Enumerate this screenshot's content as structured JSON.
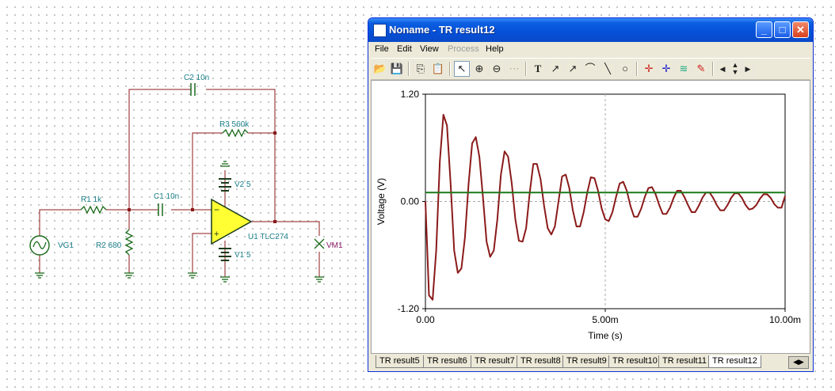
{
  "schematic": {
    "c2": "C2 10n",
    "r3": "R3 560k",
    "v2": "V2 5",
    "r1": "R1 1k",
    "c1": "C1 10n",
    "r2": "R2 680",
    "vg1": "VG1",
    "u1": "U1 TLC274",
    "vm1": "VM1",
    "v1": "V1 5"
  },
  "window": {
    "title": "Noname - TR result12",
    "menu": [
      "File",
      "Edit",
      "View",
      "Process",
      "Help"
    ],
    "minimize": "_",
    "maximize": "□",
    "close": "✕"
  },
  "toolbar_icons": [
    "open-icon",
    "save-icon",
    "copy-icon",
    "paste-icon",
    "pointer-icon",
    "zoom-in-icon",
    "zoom-100-icon",
    "grid-icon",
    "text-icon",
    "label-icon",
    "label-icon",
    "label-icon",
    "line-icon",
    "circle-icon",
    "cursor-a-icon",
    "cursor-b-icon",
    "add-curve-icon",
    "pick-icon",
    "arrow-left-icon",
    "arrow-updown-icon",
    "arrow-right-icon"
  ],
  "tabs": [
    "TR result5",
    "TR result6",
    "TR result7",
    "TR result8",
    "TR result9",
    "TR result10",
    "TR result11",
    "TR result12"
  ],
  "active_tab": "TR result12",
  "chart_data": {
    "type": "line",
    "xlabel": "Time (s)",
    "ylabel": "Voltage (V)",
    "xlim": [
      0,
      0.01
    ],
    "ylim": [
      -1.2,
      1.2
    ],
    "x_ticks": [
      "0.00",
      "5.00m",
      "10.00m"
    ],
    "y_ticks": [
      "1.20",
      "0.00",
      "-1.20"
    ],
    "grid": "dashed center lines",
    "series": [
      {
        "color": "#8b1a1a",
        "x": [
          0,
          0.0001,
          0.0002,
          0.0003,
          0.0004,
          0.0005,
          0.0006,
          0.0007,
          0.0008,
          0.0009,
          0.001,
          0.0011,
          0.0012,
          0.0013,
          0.0014,
          0.0015,
          0.0016,
          0.0017,
          0.0018,
          0.0019,
          0.002,
          0.0021,
          0.0022,
          0.0023,
          0.0024,
          0.0025,
          0.0026,
          0.0027,
          0.0028,
          0.0029,
          0.003,
          0.0031,
          0.0032,
          0.0033,
          0.0034,
          0.0035,
          0.0036,
          0.0037,
          0.0038,
          0.0039,
          0.004,
          0.0041,
          0.0042,
          0.0043,
          0.0044,
          0.0045,
          0.0046,
          0.0047,
          0.0048,
          0.0049,
          0.005,
          0.0051,
          0.0052,
          0.0053,
          0.0054,
          0.0055,
          0.0056,
          0.0057,
          0.0058,
          0.0059,
          0.006,
          0.0061,
          0.0062,
          0.0063,
          0.0064,
          0.0065,
          0.0066,
          0.0067,
          0.0068,
          0.0069,
          0.007,
          0.0071,
          0.0072,
          0.0073,
          0.0074,
          0.0075,
          0.0076,
          0.0077,
          0.0078,
          0.0079,
          0.008,
          0.0081,
          0.0082,
          0.0083,
          0.0084,
          0.0085,
          0.0086,
          0.0087,
          0.0088,
          0.0089,
          0.009,
          0.0091,
          0.0092,
          0.0093,
          0.0094,
          0.0095,
          0.0096,
          0.0097,
          0.0098,
          0.0099,
          0.01
        ],
        "y": [
          0,
          -1.05,
          -1.1,
          -0.55,
          0.45,
          0.97,
          0.85,
          0.2,
          -0.55,
          -0.8,
          -0.75,
          -0.4,
          0.2,
          0.65,
          0.72,
          0.5,
          0.05,
          -0.45,
          -0.62,
          -0.55,
          -0.2,
          0.3,
          0.56,
          0.5,
          0.2,
          -0.2,
          -0.44,
          -0.45,
          -0.3,
          0.1,
          0.42,
          0.42,
          0.25,
          -0.05,
          -0.3,
          -0.37,
          -0.28,
          0.0,
          0.28,
          0.3,
          0.15,
          -0.1,
          -0.28,
          -0.28,
          -0.12,
          0.1,
          0.27,
          0.26,
          0.12,
          -0.08,
          -0.2,
          -0.22,
          -0.12,
          0.05,
          0.2,
          0.22,
          0.12,
          -0.05,
          -0.17,
          -0.17,
          -0.08,
          0.05,
          0.15,
          0.16,
          0.08,
          -0.04,
          -0.14,
          -0.14,
          -0.07,
          0.04,
          0.12,
          0.12,
          0.05,
          -0.04,
          -0.12,
          -0.12,
          -0.05,
          0.04,
          0.1,
          0.1,
          0.04,
          -0.04,
          -0.1,
          -0.1,
          -0.04,
          0.04,
          0.09,
          0.09,
          0.04,
          -0.04,
          -0.09,
          -0.08,
          -0.04,
          0.03,
          0.08,
          0.08,
          0.04,
          -0.03,
          -0.07,
          -0.07,
          0.06
        ]
      },
      {
        "color": "#1a7a1a",
        "x": [
          0,
          0.01
        ],
        "y": [
          0.1,
          0.1
        ]
      }
    ]
  }
}
